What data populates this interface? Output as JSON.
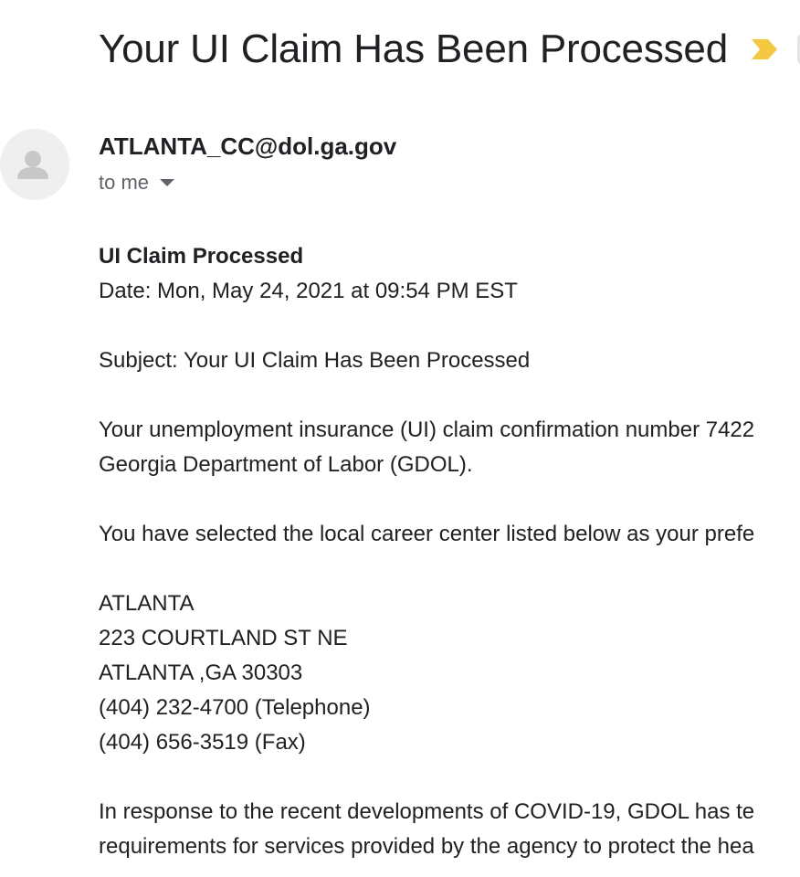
{
  "email": {
    "subject": "Your UI Claim Has Been Processed",
    "label_chip": "In",
    "sender": "ATLANTA_CC@dol.ga.gov",
    "recipient": "to me"
  },
  "body": {
    "heading": "UI Claim Processed",
    "date": "Date: Mon, May 24, 2021 at 09:54 PM EST",
    "subject_line": "Subject: Your UI Claim Has Been Processed",
    "para1_line1": "Your unemployment insurance (UI) claim confirmation number 7422",
    "para1_line2": "Georgia Department of Labor (GDOL).",
    "para2_line1": "You have selected the local career center listed below as your prefe",
    "address": {
      "name": "ATLANTA",
      "street": "223 COURTLAND ST NE",
      "city": "ATLANTA ,GA 30303",
      "phone": "(404) 232-4700 (Telephone)",
      "fax": "(404) 656-3519 (Fax)"
    },
    "para3_line1": "In response to the recent developments of COVID-19, GDOL has te",
    "para3_line2": "requirements for services provided by the agency to protect the hea"
  },
  "colors": {
    "importance_marker": "#f5c842",
    "avatar_bg": "#efefef",
    "avatar_glyph": "#c8c8c8"
  },
  "icons": {
    "importance": "importance-marker-icon",
    "avatar": "person-icon",
    "caret": "caret-down-icon"
  }
}
